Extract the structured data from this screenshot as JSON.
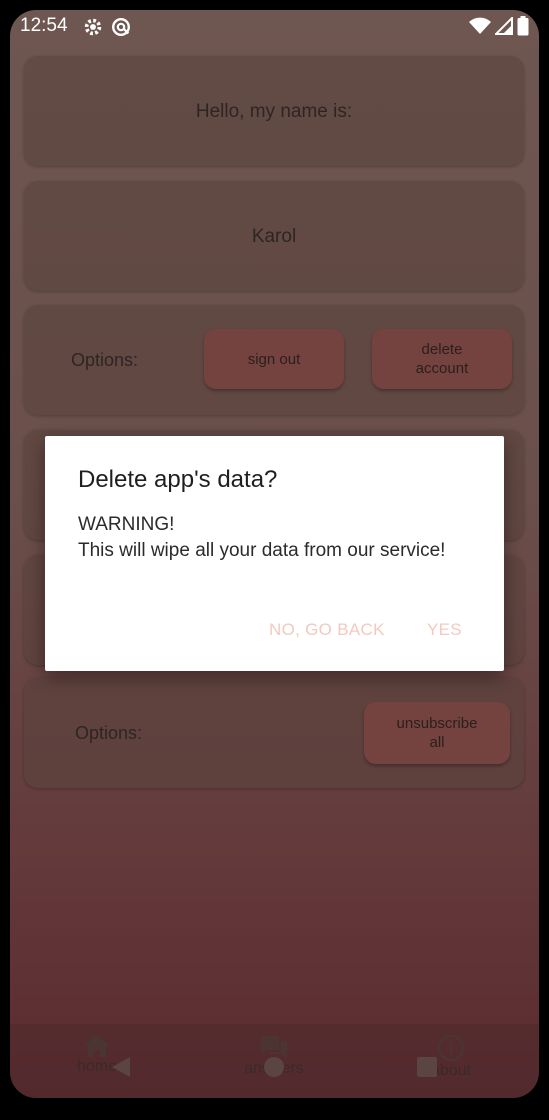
{
  "status": {
    "time": "12:54"
  },
  "profile": {
    "greeting": "Hello, my name is:",
    "name": "Karol",
    "options_label": "Options:",
    "sign_out": "sign out",
    "delete_account": "delete\naccount"
  },
  "subscriptions": {
    "options_label": "Options:",
    "unsubscribe_all": "unsubscribe\nall"
  },
  "dialog": {
    "title": "Delete app's data?",
    "message": "WARNING!\nThis will wipe all your data from our service!",
    "no_button": "NO, GO BACK",
    "yes_button": "YES"
  },
  "nav": {
    "home": "home",
    "answers": "answers",
    "about": "about"
  },
  "colors": {
    "accent_button_text": "#f3c9bf",
    "pill": "#74433f"
  }
}
